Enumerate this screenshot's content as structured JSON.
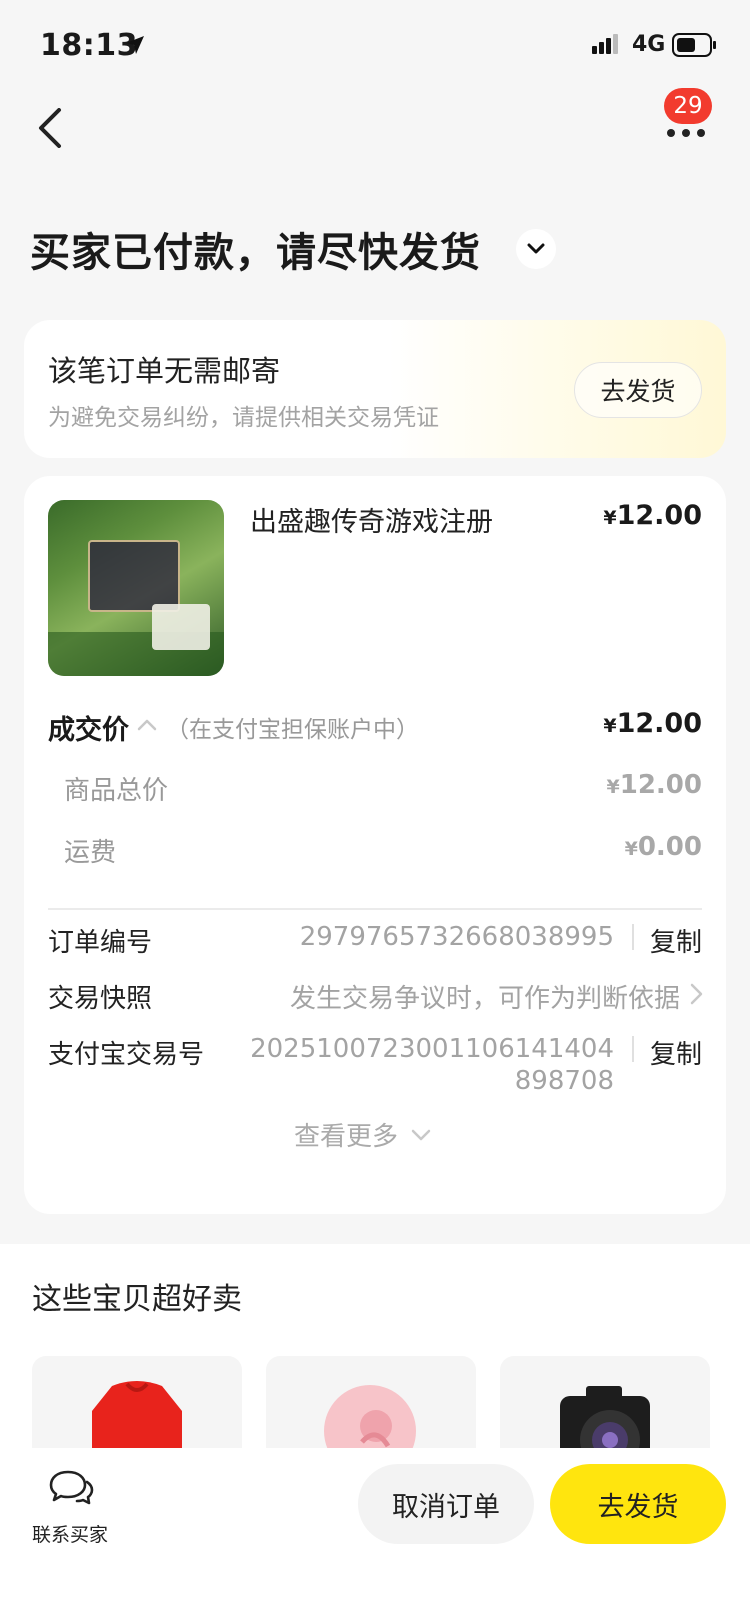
{
  "status_bar": {
    "time": "18:13",
    "network": "4G",
    "icons": [
      "location-arrow-icon",
      "signal-icon",
      "battery-icon"
    ]
  },
  "nav": {
    "back_icon": "chevron-left-icon",
    "more_icon": "more-dots-icon",
    "badge_count": "29"
  },
  "page_title": "买家已付款，请尽快发货",
  "notice": {
    "title": "该笔订单无需邮寄",
    "subtitle": "为避免交易纠纷，请提供相关交易凭证",
    "button": "去发货"
  },
  "order": {
    "product_name": "出盛趣传奇游戏注册",
    "currency": "¥",
    "product_price": "12.00",
    "deal_label": "成交价",
    "deal_note": "（在支付宝担保账户中）",
    "deal_price": "12.00",
    "subtotal_label": "商品总价",
    "subtotal": "12.00",
    "shipping_label": "运费",
    "shipping": "0.00",
    "order_no_label": "订单编号",
    "order_no": "2979765732668038995",
    "copy_label": "复制",
    "snapshot_label": "交易快照",
    "snapshot_text": "发生交易争议时，可作为判断依据",
    "alipay_no_label": "支付宝交易号",
    "alipay_no_line1": "202510072300110614140​4",
    "alipay_no_line2": "898708",
    "see_more": "查看更多"
  },
  "recommend": {
    "title": "这些宝贝超好卖"
  },
  "bottom_bar": {
    "contact_label": "联系买家",
    "cancel_button": "取消订单",
    "ship_button": "去发货"
  },
  "colors": {
    "accent_yellow": "#ffe50e",
    "badge_red": "#f23b2e",
    "muted_text": "#a3a3a3"
  }
}
